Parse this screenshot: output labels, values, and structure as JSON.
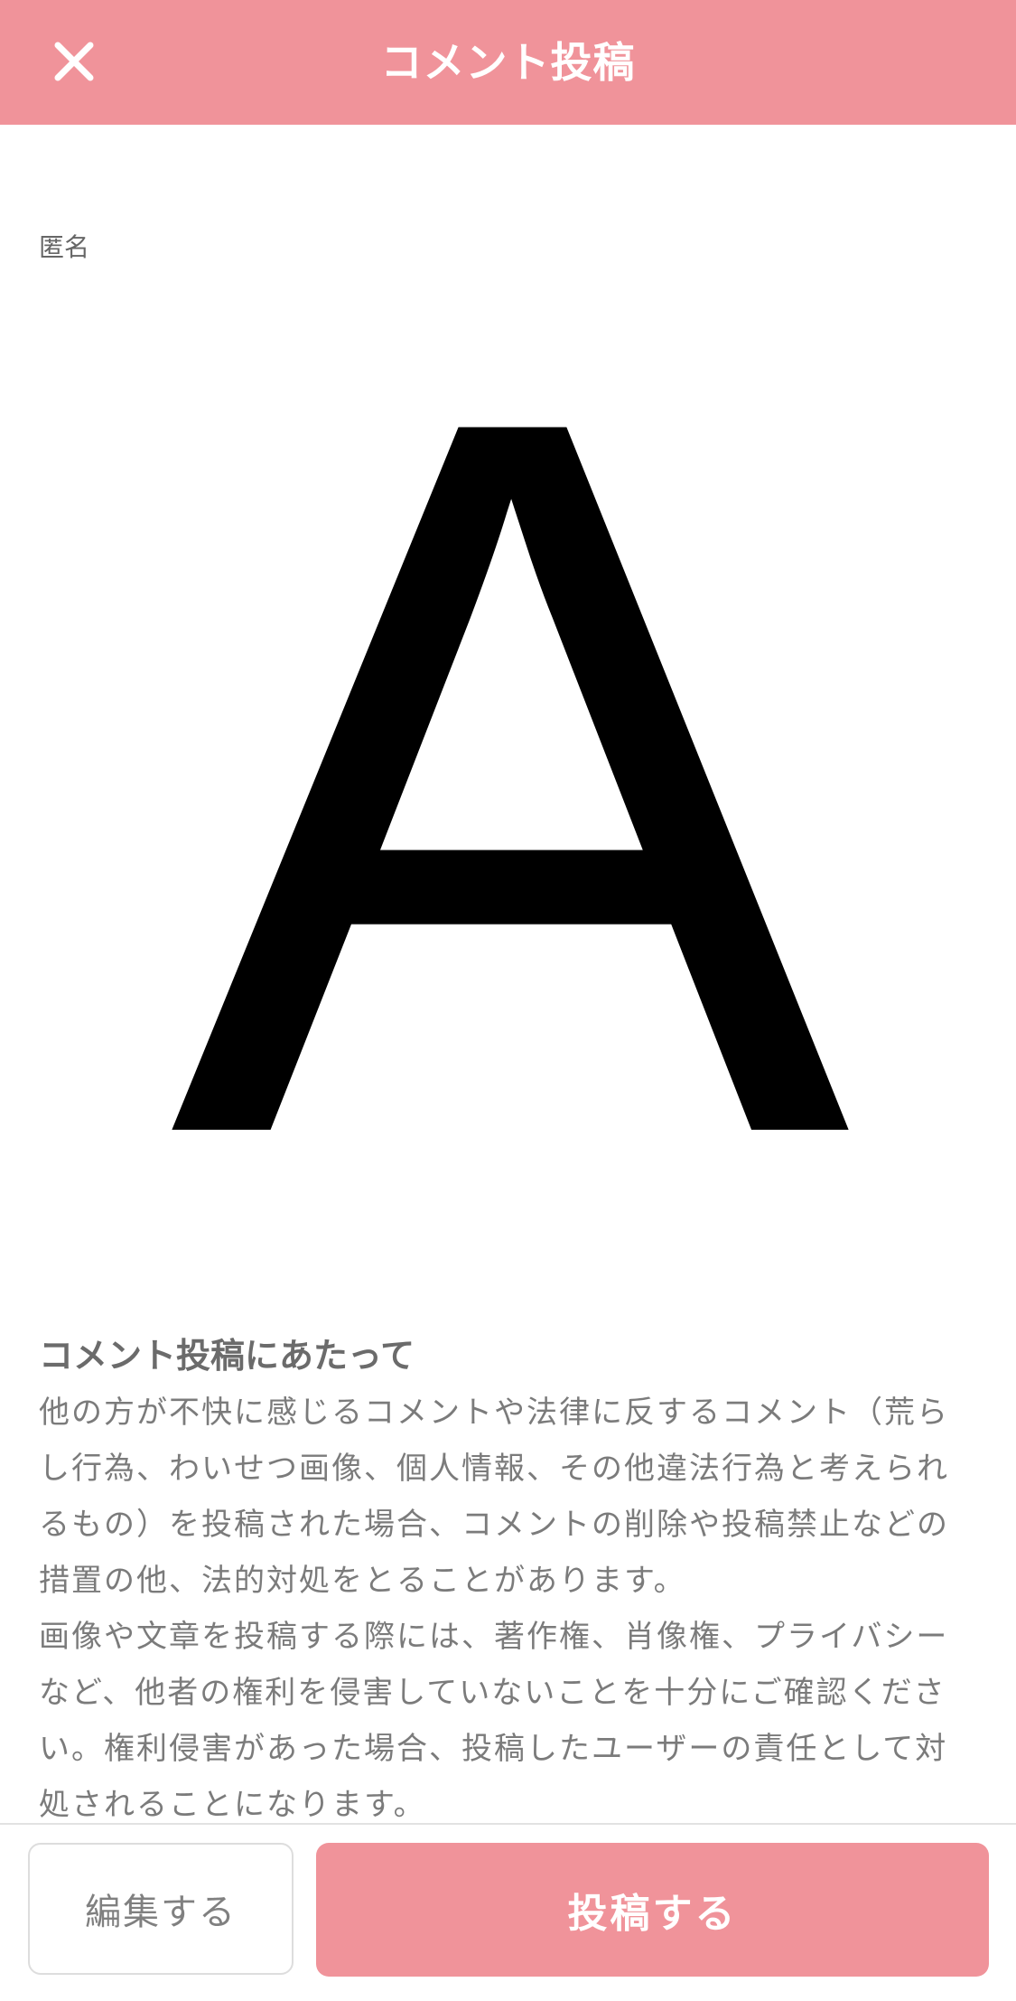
{
  "header": {
    "title": "コメント投稿",
    "close_icon": "close-icon"
  },
  "author": {
    "label": "匿名"
  },
  "comment": {
    "text": "A"
  },
  "notice": {
    "title": "コメント投稿にあたって",
    "paragraph_1": "他の方が不快に感じるコメントや法律に反するコメント（荒らし行為、わいせつ画像、個人情報、その他違法行為と考えられるもの）を投稿された場合、コメントの削除や投稿禁止などの措置の他、法的対処をとることがあります。",
    "paragraph_2": "画像や文章を投稿する際には、著作権、肖像権、プライバシーなど、他者の権利を侵害していないことを十分にご確認ください。権利侵害があった場合、投稿したユーザーの責任として対処されることになります。"
  },
  "footer": {
    "edit_label": "編集する",
    "post_label": "投稿する"
  },
  "colors": {
    "accent": "#f0939a",
    "text_gray": "#7b7b7b",
    "border": "#dddddd"
  }
}
